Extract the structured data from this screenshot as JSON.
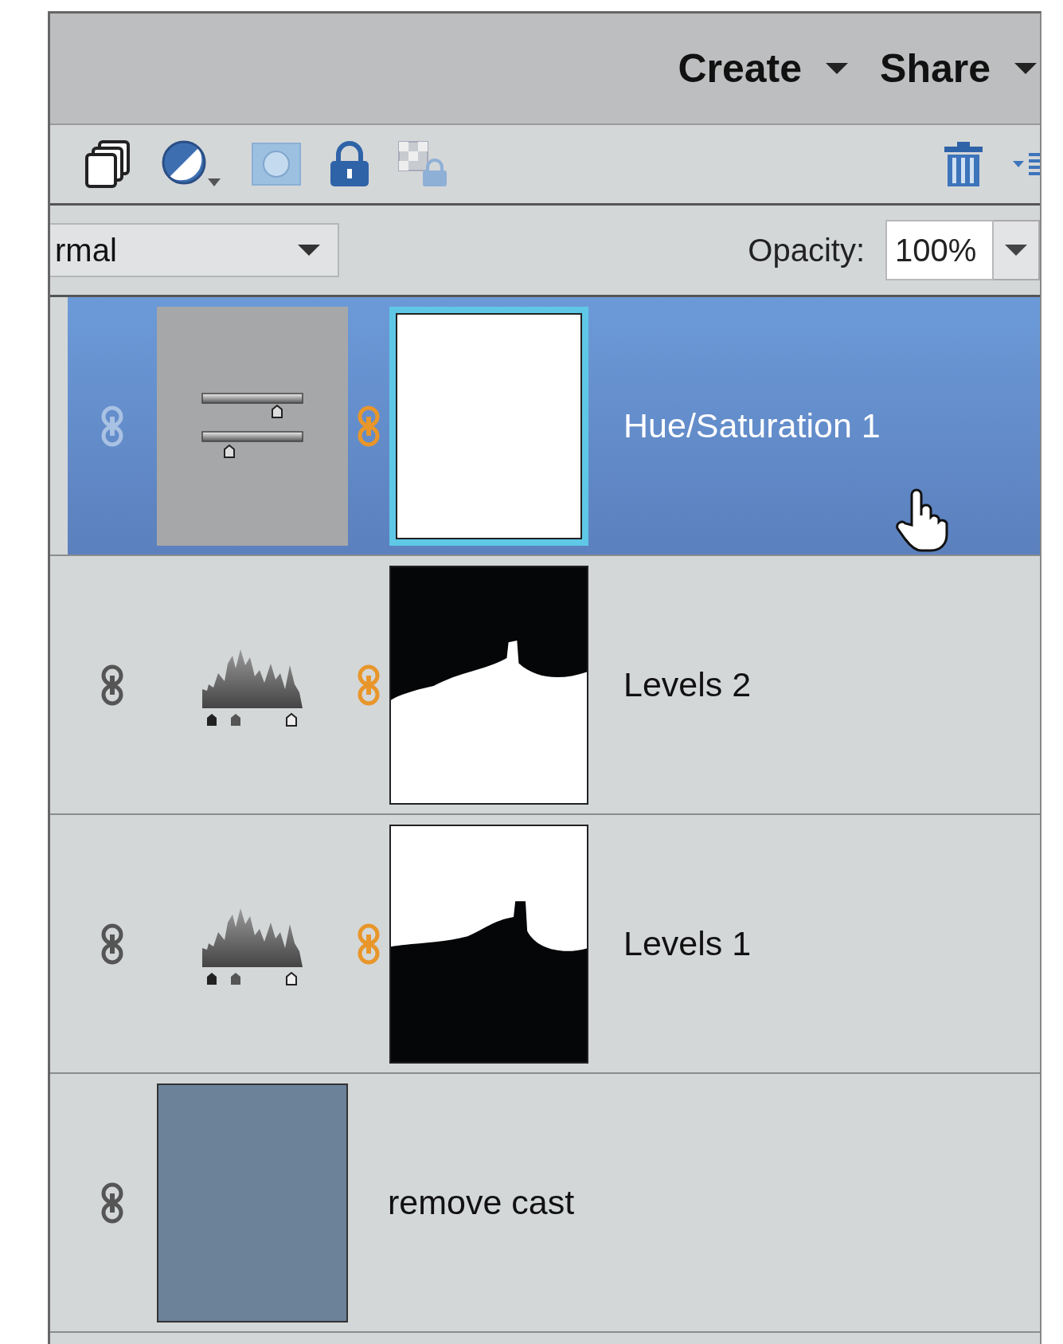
{
  "header": {
    "menus": [
      {
        "label": "Create"
      },
      {
        "label": "Share"
      }
    ]
  },
  "blend_mode": {
    "value": "rmal"
  },
  "opacity": {
    "label": "Opacity:",
    "value": "100%"
  },
  "layers": [
    {
      "name": "Hue/Saturation 1",
      "selected": true,
      "kind": "hue_saturation",
      "mask": {
        "kind": "white"
      }
    },
    {
      "name": "Levels 2",
      "selected": false,
      "kind": "levels",
      "mask": {
        "kind": "dark_top"
      }
    },
    {
      "name": "Levels 1",
      "selected": false,
      "kind": "levels",
      "mask": {
        "kind": "light_top"
      }
    },
    {
      "name": "remove cast",
      "selected": false,
      "kind": "fill",
      "color": "#6b8299"
    }
  ]
}
